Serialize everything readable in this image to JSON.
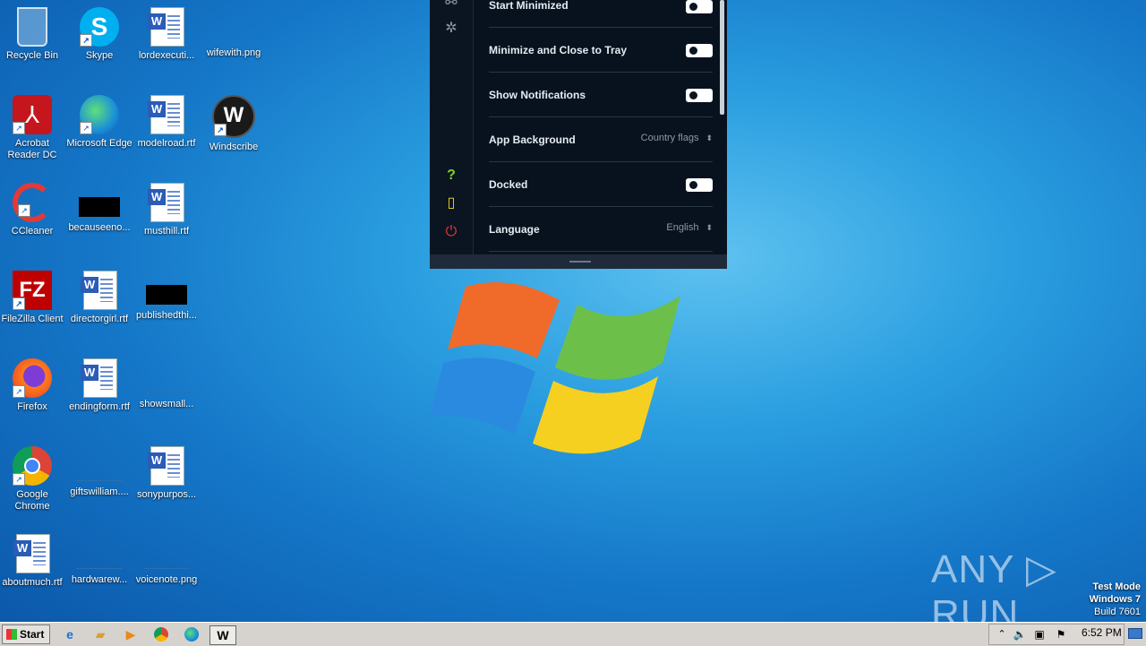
{
  "desktop": {
    "icons": [
      {
        "label": "Recycle Bin"
      },
      {
        "label": "Skype"
      },
      {
        "label": "lordexecuti..."
      },
      {
        "label": "wifewith.png"
      },
      {
        "label": "Acrobat Reader DC"
      },
      {
        "label": "Microsoft Edge"
      },
      {
        "label": "modelroad.rtf"
      },
      {
        "label": "Windscribe"
      },
      {
        "label": "CCleaner"
      },
      {
        "label": "becauseeno..."
      },
      {
        "label": "musthill.rtf"
      },
      {
        "label": "FileZilla Client"
      },
      {
        "label": "directorgirl.rtf"
      },
      {
        "label": "publishedthi..."
      },
      {
        "label": "Firefox"
      },
      {
        "label": "endingform.rtf"
      },
      {
        "label": "showsmall..."
      },
      {
        "label": "Google Chrome"
      },
      {
        "label": "giftswilliam...."
      },
      {
        "label": "sonypurpos..."
      },
      {
        "label": "aboutmuch.rtf"
      },
      {
        "label": "hardwarew..."
      },
      {
        "label": "voicenote.png"
      }
    ]
  },
  "app": {
    "settings": [
      {
        "label": "Start Minimized",
        "type": "toggle"
      },
      {
        "label": "Minimize and Close to Tray",
        "type": "toggle"
      },
      {
        "label": "Show Notifications",
        "type": "toggle"
      },
      {
        "label": "App Background",
        "type": "select",
        "value": "Country flags"
      },
      {
        "label": "Docked",
        "type": "toggle"
      },
      {
        "label": "Language",
        "type": "select",
        "value": "English"
      }
    ],
    "sidebar_icons": [
      "share-icon",
      "bug-icon",
      "help-icon",
      "news-icon",
      "power-icon"
    ]
  },
  "watermark": {
    "text": "ANY ▷ RUN"
  },
  "system": {
    "test_mode": "Test Mode",
    "os": "Windows 7",
    "build": "Build 7601"
  },
  "taskbar": {
    "start_label": "Start",
    "clock": "6:52 PM"
  },
  "colors": {
    "app_bg": "#08121f",
    "help_icon": "#7ed321",
    "news_icon": "#f5d90a",
    "power_icon": "#e53935"
  }
}
